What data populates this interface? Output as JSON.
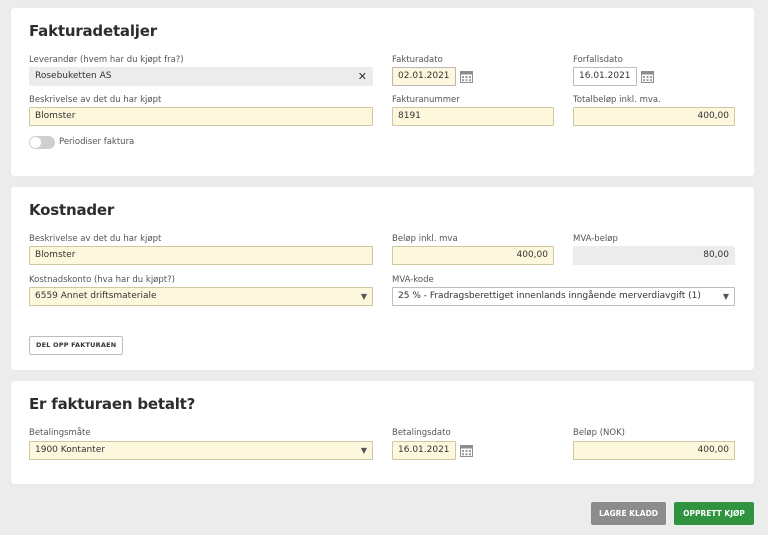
{
  "invoice": {
    "title": "Fakturadetaljer",
    "supplier_label": "Leverandør (hvem har du kjøpt fra?)",
    "supplier_value": "Rosebuketten AS",
    "invoice_date_label": "Fakturadato",
    "invoice_date_value": "02.01.2021",
    "due_date_label": "Forfallsdato",
    "due_date_value": "16.01.2021",
    "description_label": "Beskrivelse av det du har kjøpt",
    "description_value": "Blomster",
    "invoice_number_label": "Fakturanummer",
    "invoice_number_value": "8191",
    "total_label": "Totalbeløp inkl. mva.",
    "total_value": "400,00",
    "periodize_label": "Periodiser faktura"
  },
  "costs": {
    "title": "Kostnader",
    "description_label": "Beskrivelse av det du har kjøpt",
    "description_value": "Blomster",
    "amount_label": "Beløp inkl. mva",
    "amount_value": "400,00",
    "vat_amount_label": "MVA-beløp",
    "vat_amount_value": "80,00",
    "account_label": "Kostnadskonto (hva har du kjøpt?)",
    "account_value": "6559 Annet driftsmateriale",
    "vat_code_label": "MVA-kode",
    "vat_code_value": "25 % - Fradragsberettiget innenlands inngående merverdiavgift (1)",
    "split_button": "DEL OPP FAKTURAEN"
  },
  "payment": {
    "title": "Er fakturaen betalt?",
    "method_label": "Betalingsmåte",
    "method_value": "1900 Kontanter",
    "date_label": "Betalingsdato",
    "date_value": "16.01.2021",
    "amount_label": "Beløp (NOK)",
    "amount_value": "400,00"
  },
  "actions": {
    "draft_button": "LAGRE KLADD",
    "create_button": "OPPRETT KJØP"
  },
  "colors": {
    "field_bg": "#fdf8dd",
    "primary_green": "#2f9340",
    "secondary_gray": "#8a8c8e"
  },
  "icons": {
    "clear": "close-icon",
    "calendar": "calendar-icon",
    "dropdown": "chevron-down-icon"
  }
}
